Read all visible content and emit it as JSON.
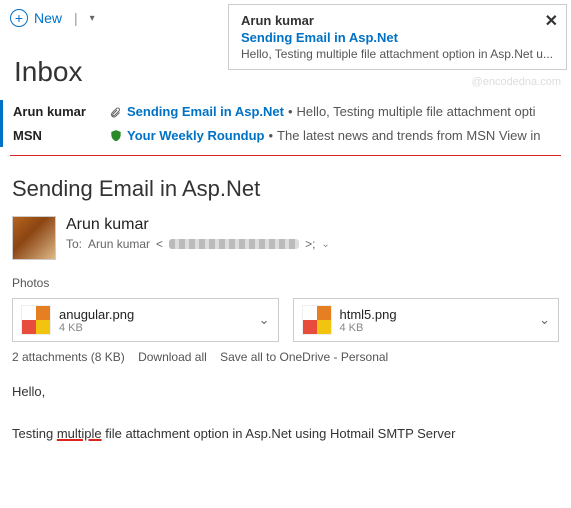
{
  "toolbar": {
    "new_label": "New"
  },
  "popup": {
    "sender": "Arun kumar",
    "subject": "Sending Email in Asp.Net",
    "preview": "Hello,  Testing multiple file attachment option in Asp.Net u..."
  },
  "inbox": {
    "title": "Inbox"
  },
  "messages": [
    {
      "sender": "Arun kumar",
      "icon": "clip",
      "subject": "Sending Email in Asp.Net",
      "preview": "Hello,  Testing multiple file attachment opti"
    },
    {
      "sender": "MSN",
      "icon": "shield",
      "subject": "Your Weekly Roundup",
      "preview": "The latest news and trends from MSN View in"
    }
  ],
  "mail": {
    "subject": "Sending Email in Asp.Net",
    "from": "Arun kumar",
    "to_label": "To:",
    "to_name": "Arun kumar",
    "photos_label": "Photos",
    "attachments": [
      {
        "name": "anugular.png",
        "size": "4 KB"
      },
      {
        "name": "html5.png",
        "size": "4 KB"
      }
    ],
    "attach_summary": "2 attachments (8 KB)",
    "download_all": "Download all",
    "save_onedrive": "Save all to OneDrive - Personal",
    "body_greeting": "Hello,",
    "body_pre": "Testing ",
    "body_underlined": "multiple",
    "body_post": " file attachment option in Asp.Net using Hotmail SMTP Server"
  },
  "watermark": "@encodedna.com"
}
